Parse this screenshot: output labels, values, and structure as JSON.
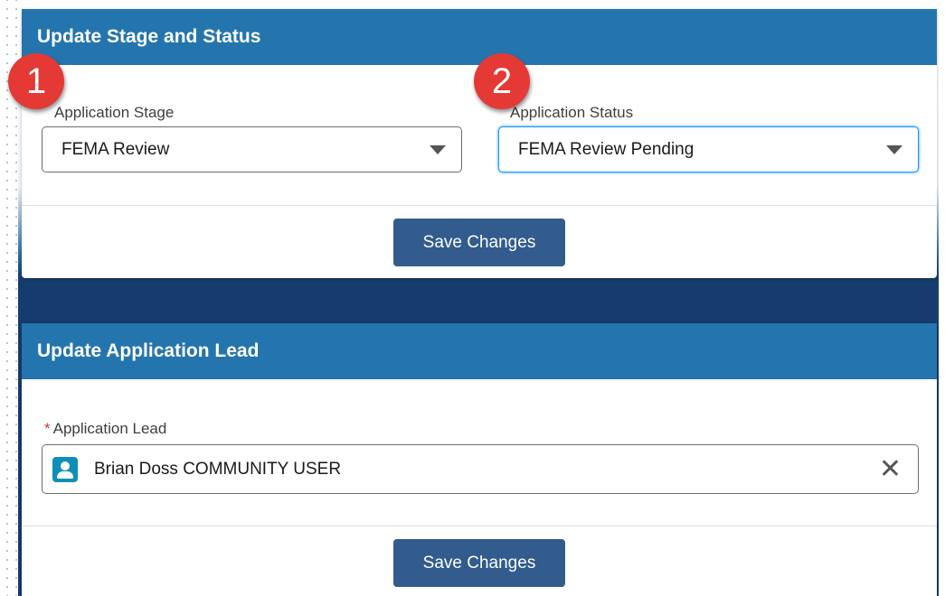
{
  "stage_status_card": {
    "title": "Update Stage and Status",
    "badge_1": "1",
    "badge_2": "2",
    "stage": {
      "label": "Application Stage",
      "value": "FEMA Review"
    },
    "status": {
      "label": "Application Status",
      "value": "FEMA Review Pending"
    },
    "save_label": "Save Changes"
  },
  "lead_card": {
    "title": "Update Application Lead",
    "required_marker": "*",
    "lead": {
      "label": "Application Lead",
      "value": "Brian Doss COMMUNITY USER"
    },
    "clear_symbol": "✕",
    "save_label": "Save Changes"
  },
  "icons": [
    "chevron-down-icon",
    "user-icon",
    "close-icon"
  ],
  "colors": {
    "header": "#2475ad",
    "button": "#325b8e",
    "badge": "#e53935",
    "focus": "#1b96ff"
  }
}
